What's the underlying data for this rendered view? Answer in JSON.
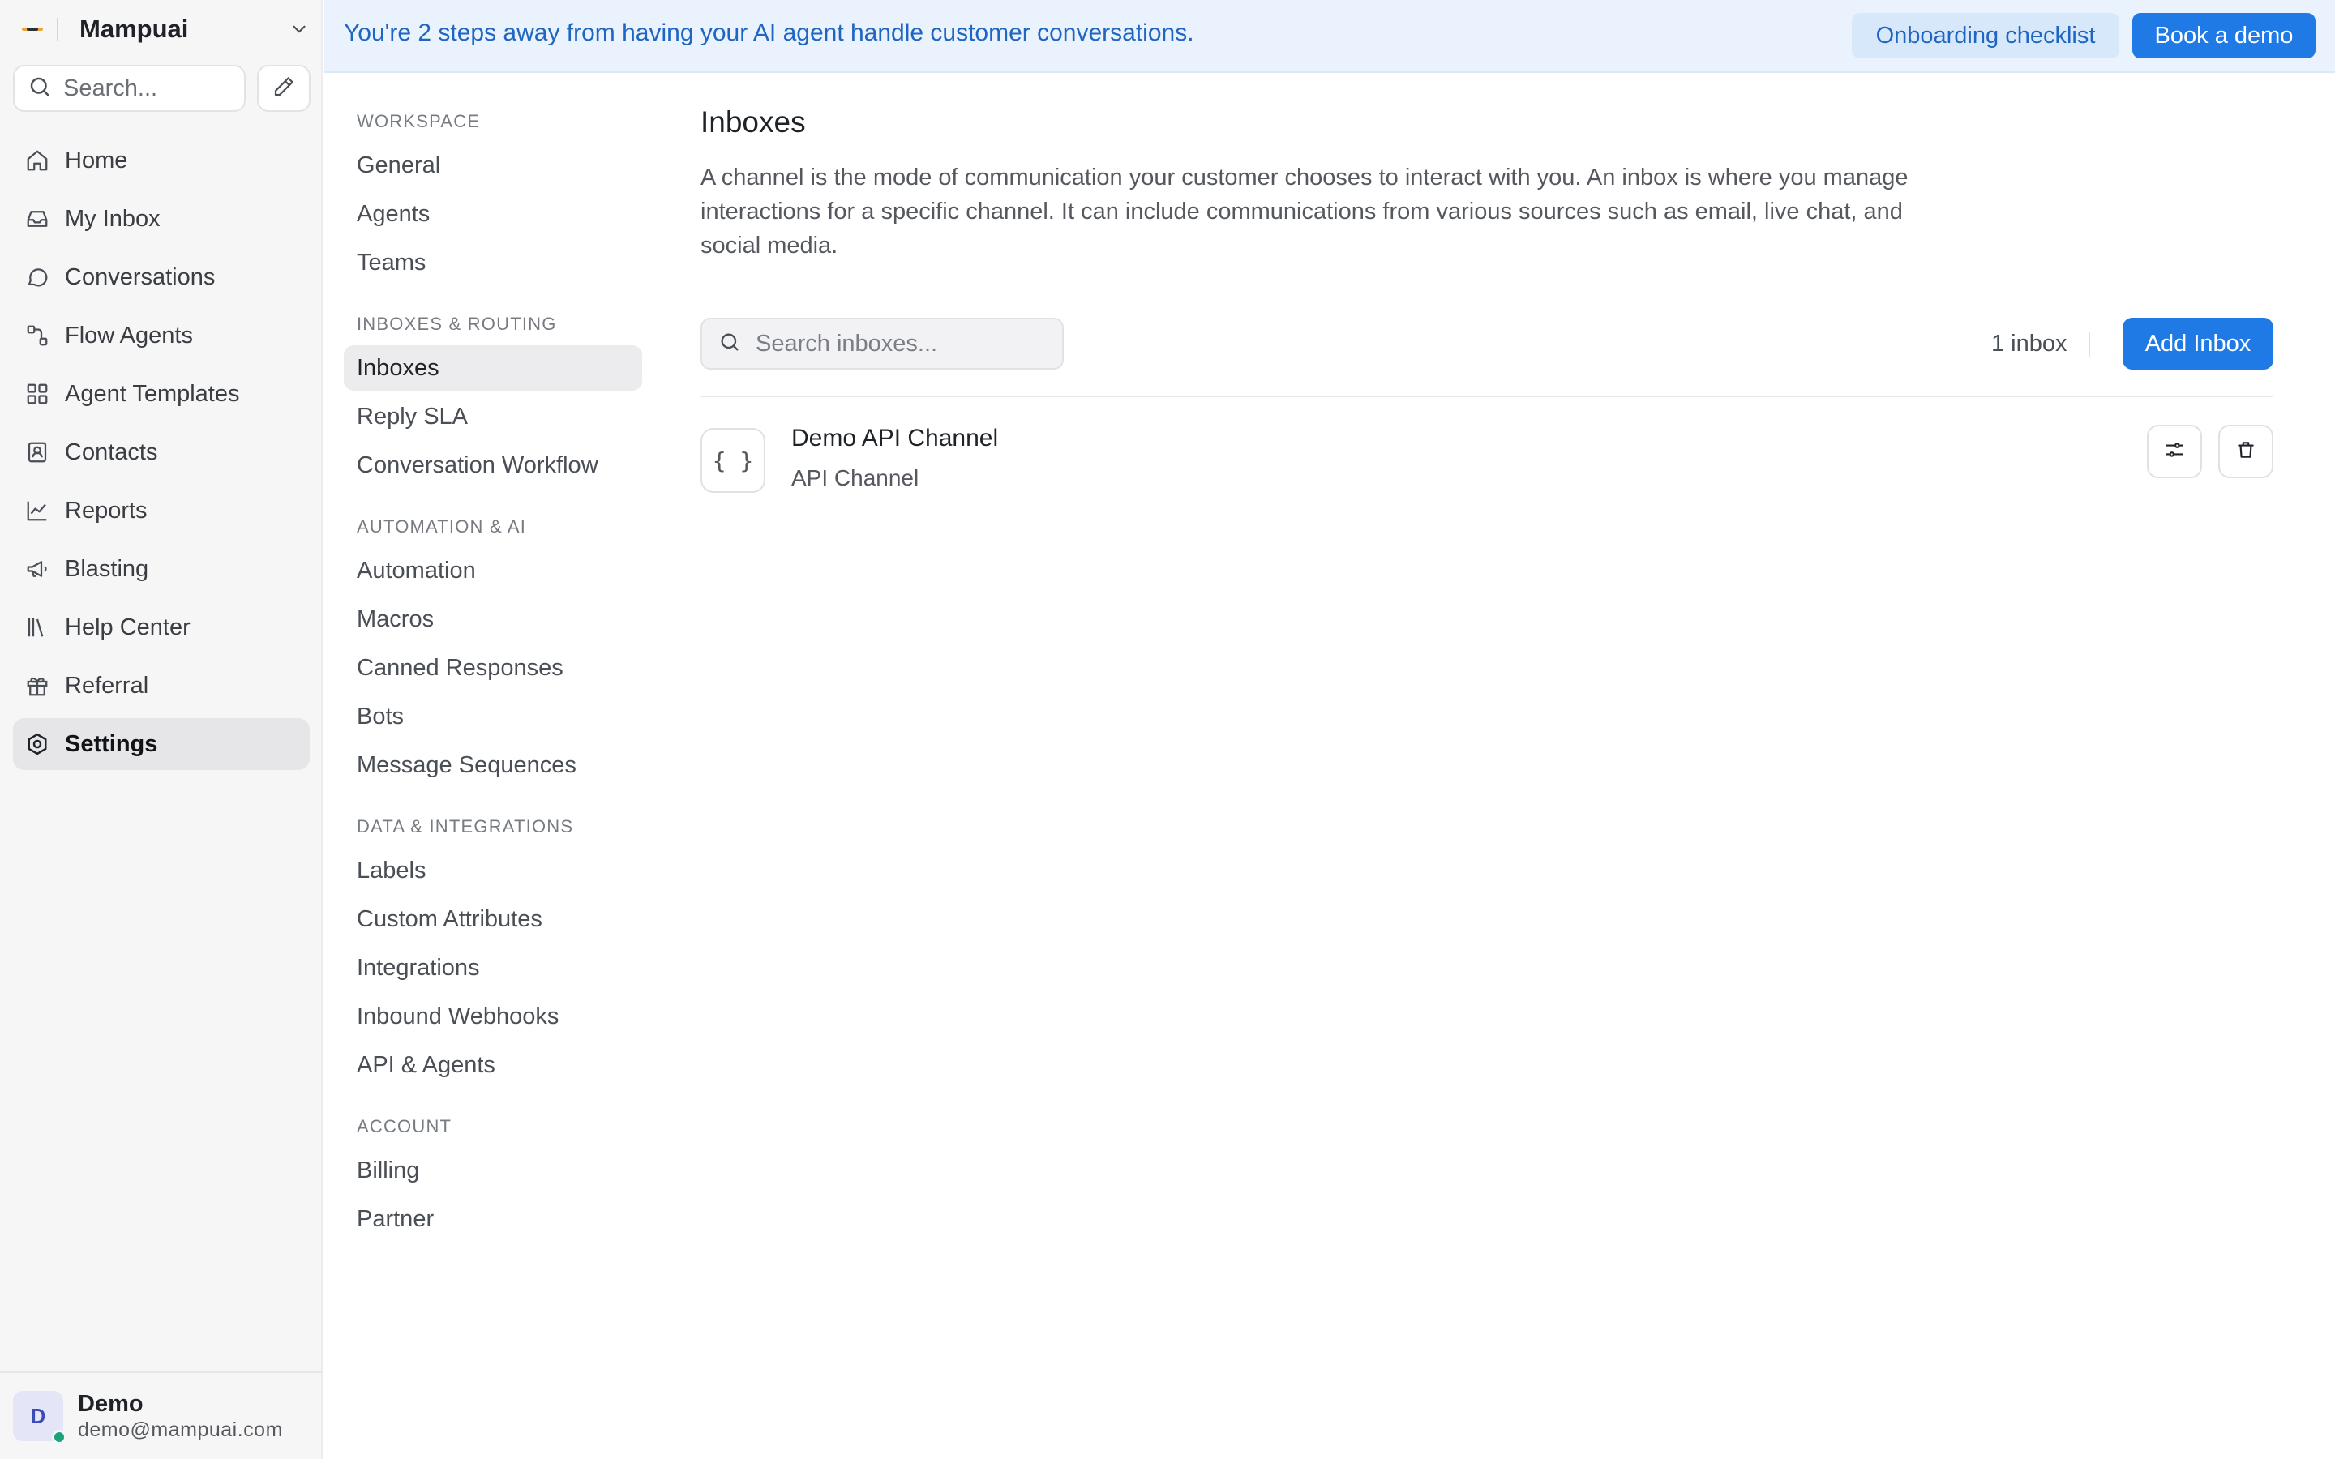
{
  "brand": {
    "name": "Mampuai"
  },
  "sidebar": {
    "search_placeholder": "Search...",
    "nav": [
      {
        "label": "Home",
        "icon": "home-icon"
      },
      {
        "label": "My Inbox",
        "icon": "inbox-icon"
      },
      {
        "label": "Conversations",
        "icon": "chat-bubble-icon"
      },
      {
        "label": "Flow Agents",
        "icon": "flow-icon"
      },
      {
        "label": "Agent Templates",
        "icon": "grid-icon"
      },
      {
        "label": "Contacts",
        "icon": "contact-card-icon"
      },
      {
        "label": "Reports",
        "icon": "chart-line-icon"
      },
      {
        "label": "Blasting",
        "icon": "megaphone-icon"
      },
      {
        "label": "Help Center",
        "icon": "library-icon"
      },
      {
        "label": "Referral",
        "icon": "gift-icon"
      },
      {
        "label": "Settings",
        "icon": "settings-icon",
        "active": true
      }
    ],
    "user": {
      "initial": "D",
      "name": "Demo",
      "email": "demo@mampuai.com",
      "status_color": "#1aa37a"
    }
  },
  "banner": {
    "text": "You're 2 steps away from having your AI agent handle customer conversations.",
    "checklist_label": "Onboarding checklist",
    "demo_label": "Book a demo"
  },
  "settings_menu": {
    "sections": [
      {
        "title": "WORKSPACE",
        "items": [
          "General",
          "Agents",
          "Teams"
        ]
      },
      {
        "title": "INBOXES & ROUTING",
        "items": [
          "Inboxes",
          "Reply SLA",
          "Conversation Workflow"
        ]
      },
      {
        "title": "AUTOMATION & AI",
        "items": [
          "Automation",
          "Macros",
          "Canned Responses",
          "Bots",
          "Message Sequences"
        ]
      },
      {
        "title": "DATA & INTEGRATIONS",
        "items": [
          "Labels",
          "Custom Attributes",
          "Integrations",
          "Inbound Webhooks",
          "API & Agents"
        ]
      },
      {
        "title": "ACCOUNT",
        "items": [
          "Billing",
          "Partner"
        ]
      }
    ],
    "active": "Inboxes"
  },
  "main": {
    "title": "Inboxes",
    "description": "A channel is the mode of communication your customer chooses to interact with you. An inbox is where you manage interactions for a specific channel. It can include communications from various sources such as email, live chat, and social media.",
    "search_placeholder": "Search inboxes...",
    "count_label": "1 inbox",
    "add_label": "Add Inbox",
    "inboxes": [
      {
        "name": "Demo API Channel",
        "type": "API Channel",
        "icon_glyph": "{ }"
      }
    ]
  },
  "colors": {
    "accent": "#1f7ae6",
    "banner_bg": "#eaf3fd",
    "banner_text": "#1f66c2",
    "sidebar_bg": "#f6f6f7"
  }
}
